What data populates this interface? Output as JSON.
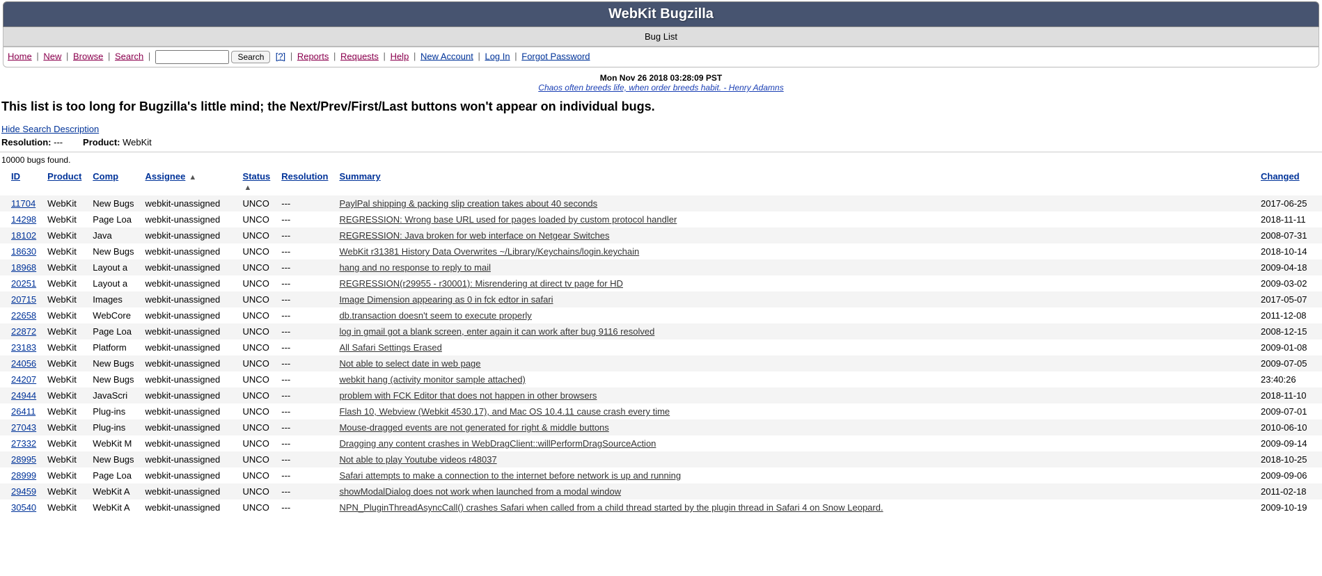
{
  "banner": {
    "title": "WebKit Bugzilla",
    "subtitle": "Bug List"
  },
  "nav": {
    "home": "Home",
    "new": "New",
    "browse": "Browse",
    "search_link": "Search",
    "search_btn": "Search",
    "help_q": "[?]",
    "reports": "Reports",
    "requests": "Requests",
    "help": "Help",
    "new_account": "New Account",
    "login": "Log In",
    "forgot": "Forgot Password"
  },
  "meta": {
    "timestamp": "Mon Nov 26 2018 03:28:09 PST",
    "quote": "Chaos often breeds life, when order breeds habit. - Henry Adamns"
  },
  "warning": "This list is too long for Bugzilla's little mind; the Next/Prev/First/Last buttons won't appear on individual bugs.",
  "hide_search": "Hide Search Description",
  "filters": {
    "resolution_label": "Resolution:",
    "resolution_value": "---",
    "product_label": "Product:",
    "product_value": "WebKit"
  },
  "count_text": "10000 bugs found.",
  "columns": {
    "id": "ID",
    "product": "Product",
    "comp": "Comp",
    "assignee": "Assignee",
    "status": "Status",
    "resolution": "Resolution",
    "summary": "Summary",
    "changed": "Changed"
  },
  "bugs": [
    {
      "id": "11704",
      "product": "WebKit",
      "comp": "New Bugs",
      "assignee": "webkit-unassigned",
      "status": "UNCO",
      "resolution": "---",
      "summary": "PaylPal shipping & packing slip creation takes about 40 seconds",
      "changed": "2017-06-25"
    },
    {
      "id": "14298",
      "product": "WebKit",
      "comp": "Page Loa",
      "assignee": "webkit-unassigned",
      "status": "UNCO",
      "resolution": "---",
      "summary": "REGRESSION: Wrong base URL used for pages loaded by custom protocol handler",
      "changed": "2018-11-11"
    },
    {
      "id": "18102",
      "product": "WebKit",
      "comp": "Java",
      "assignee": "webkit-unassigned",
      "status": "UNCO",
      "resolution": "---",
      "summary": "REGRESSION: Java broken for web interface on Netgear Switches",
      "changed": "2008-07-31"
    },
    {
      "id": "18630",
      "product": "WebKit",
      "comp": "New Bugs",
      "assignee": "webkit-unassigned",
      "status": "UNCO",
      "resolution": "---",
      "summary": "WebKit r31381 History Data Overwrites ~/Library/Keychains/login.keychain",
      "changed": "2018-10-14"
    },
    {
      "id": "18968",
      "product": "WebKit",
      "comp": "Layout a",
      "assignee": "webkit-unassigned",
      "status": "UNCO",
      "resolution": "---",
      "summary": "hang and no response to reply to mail",
      "changed": "2009-04-18"
    },
    {
      "id": "20251",
      "product": "WebKit",
      "comp": "Layout a",
      "assignee": "webkit-unassigned",
      "status": "UNCO",
      "resolution": "---",
      "summary": "REGRESSION(r29955 - r30001): Misrendering at direct tv page for HD",
      "changed": "2009-03-02"
    },
    {
      "id": "20715",
      "product": "WebKit",
      "comp": "Images",
      "assignee": "webkit-unassigned",
      "status": "UNCO",
      "resolution": "---",
      "summary": "Image Dimension appearing as 0 in fck edtor in safari",
      "changed": "2017-05-07"
    },
    {
      "id": "22658",
      "product": "WebKit",
      "comp": "WebCore",
      "assignee": "webkit-unassigned",
      "status": "UNCO",
      "resolution": "---",
      "summary": "db.transaction doesn't seem to execute properly",
      "changed": "2011-12-08"
    },
    {
      "id": "22872",
      "product": "WebKit",
      "comp": "Page Loa",
      "assignee": "webkit-unassigned",
      "status": "UNCO",
      "resolution": "---",
      "summary": "log in gmail got a blank screen, enter again it can work after bug 9116 resolved",
      "changed": "2008-12-15"
    },
    {
      "id": "23183",
      "product": "WebKit",
      "comp": "Platform",
      "assignee": "webkit-unassigned",
      "status": "UNCO",
      "resolution": "---",
      "summary": "All Safari Settings Erased",
      "changed": "2009-01-08"
    },
    {
      "id": "24056",
      "product": "WebKit",
      "comp": "New Bugs",
      "assignee": "webkit-unassigned",
      "status": "UNCO",
      "resolution": "---",
      "summary": "Not able to select date in web page",
      "changed": "2009-07-05"
    },
    {
      "id": "24207",
      "product": "WebKit",
      "comp": "New Bugs",
      "assignee": "webkit-unassigned",
      "status": "UNCO",
      "resolution": "---",
      "summary": "webkit hang (activity monitor sample attached)",
      "changed": "23:40:26"
    },
    {
      "id": "24944",
      "product": "WebKit",
      "comp": "JavaScri",
      "assignee": "webkit-unassigned",
      "status": "UNCO",
      "resolution": "---",
      "summary": "problem with FCK Editor that does not happen in other browsers",
      "changed": "2018-11-10"
    },
    {
      "id": "26411",
      "product": "WebKit",
      "comp": "Plug-ins",
      "assignee": "webkit-unassigned",
      "status": "UNCO",
      "resolution": "---",
      "summary": "Flash 10, Webview (Webkit 4530.17), and Mac OS 10.4.11 cause crash every time",
      "changed": "2009-07-01"
    },
    {
      "id": "27043",
      "product": "WebKit",
      "comp": "Plug-ins",
      "assignee": "webkit-unassigned",
      "status": "UNCO",
      "resolution": "---",
      "summary": "Mouse-dragged events are not generated for right & middle buttons",
      "changed": "2010-06-10"
    },
    {
      "id": "27332",
      "product": "WebKit",
      "comp": "WebKit M",
      "assignee": "webkit-unassigned",
      "status": "UNCO",
      "resolution": "---",
      "summary": "Dragging any content crashes in WebDragClient::willPerformDragSourceAction",
      "changed": "2009-09-14"
    },
    {
      "id": "28995",
      "product": "WebKit",
      "comp": "New Bugs",
      "assignee": "webkit-unassigned",
      "status": "UNCO",
      "resolution": "---",
      "summary": "Not able to play Youtube videos r48037",
      "changed": "2018-10-25"
    },
    {
      "id": "28999",
      "product": "WebKit",
      "comp": "Page Loa",
      "assignee": "webkit-unassigned",
      "status": "UNCO",
      "resolution": "---",
      "summary": "Safari attempts to make a connection to the internet before network is up and running",
      "changed": "2009-09-06"
    },
    {
      "id": "29459",
      "product": "WebKit",
      "comp": "WebKit A",
      "assignee": "webkit-unassigned",
      "status": "UNCO",
      "resolution": "---",
      "summary": "showModalDialog does not work when launched from a modal window",
      "changed": "2011-02-18"
    },
    {
      "id": "30540",
      "product": "WebKit",
      "comp": "WebKit A",
      "assignee": "webkit-unassigned",
      "status": "UNCO",
      "resolution": "---",
      "summary": "NPN_PluginThreadAsyncCall() crashes Safari when called from a child thread started by the plugin thread in Safari 4 on Snow Leopard.",
      "changed": "2009-10-19"
    }
  ]
}
